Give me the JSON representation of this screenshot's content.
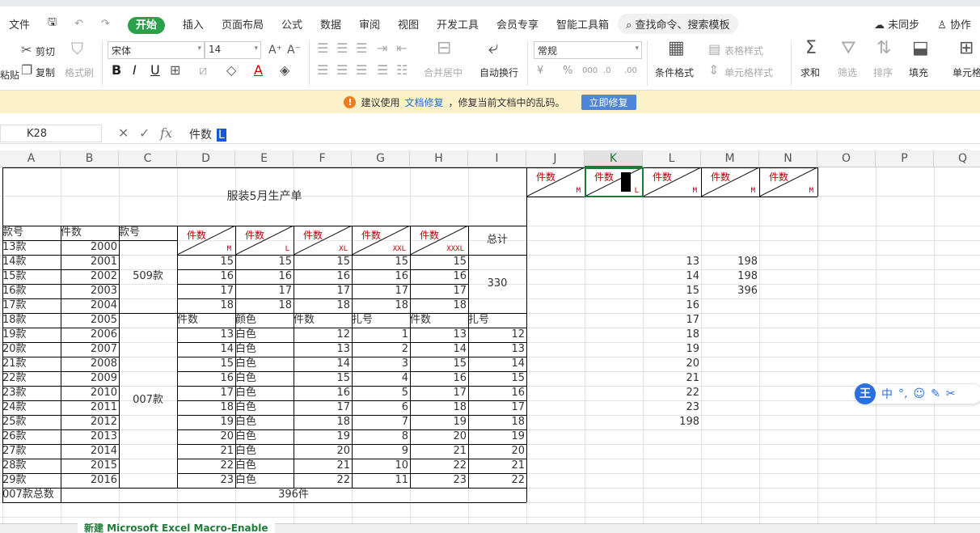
{
  "menubar": {
    "file": "文件",
    "items": [
      "开始",
      "插入",
      "页面布局",
      "公式",
      "数据",
      "审阅",
      "视图",
      "开发工具",
      "会员专享",
      "智能工具箱"
    ],
    "search": "查找命令、搜索模板",
    "sync": "未同步",
    "collab": "协作"
  },
  "ribbon": {
    "cut": "剪切",
    "copy": "复制",
    "format_painter": "格式刷",
    "font_name": "宋体",
    "font_size": "14",
    "merge": "合并居中",
    "wrap": "自动换行",
    "number_format": "常规",
    "cond_format": "条件格式",
    "table_style": "表格样式",
    "cell_style": "单元格样式",
    "sum": "求和",
    "filter": "筛选",
    "sort": "排序",
    "fill": "填充",
    "cell": "单元格",
    "paste": "粘贴"
  },
  "notice": {
    "text1": "建议使用",
    "link": "文档修复",
    "text2": "，修复当前文档中的乱码。",
    "button": "立即修复"
  },
  "formula": {
    "cell_ref": "K28",
    "content": "件数",
    "cursor": "L"
  },
  "columns": [
    "A",
    "B",
    "C",
    "D",
    "E",
    "F",
    "G",
    "H",
    "I",
    "J",
    "K",
    "L",
    "M",
    "N",
    "O",
    "P",
    "Q"
  ],
  "active_column": "K",
  "sheet": {
    "title": "服装5月生产单",
    "headers": {
      "style": "款号",
      "qty": "件数",
      "model": "款号",
      "total": "总计"
    },
    "diag_top": "件数",
    "sizes": [
      "M",
      "L",
      "XL",
      "XXL",
      "XXXL"
    ],
    "jn_sizes": [
      "M",
      "L",
      "M",
      "M",
      "M"
    ],
    "group1_label": "509款",
    "group1_total": "330",
    "group1_rows": [
      {
        "style": "13款",
        "qty": "2000",
        "vals": [
          "",
          "",
          "",
          "",
          ""
        ]
      },
      {
        "style": "14款",
        "qty": "2001",
        "vals": [
          "15",
          "15",
          "15",
          "15",
          "15"
        ]
      },
      {
        "style": "15款",
        "qty": "2002",
        "vals": [
          "16",
          "16",
          "16",
          "16",
          "16"
        ]
      },
      {
        "style": "16款",
        "qty": "2003",
        "vals": [
          "17",
          "17",
          "17",
          "17",
          "17"
        ]
      },
      {
        "style": "17款",
        "qty": "2004",
        "vals": [
          "18",
          "18",
          "18",
          "18",
          "18"
        ]
      }
    ],
    "group2_label": "007款",
    "group2_headers": [
      "件数",
      "颜色",
      "件数",
      "扎号",
      "件数",
      "扎号"
    ],
    "group2_rows": [
      {
        "style": "18款",
        "qty": "2005"
      },
      {
        "style": "19款",
        "qty": "2006",
        "d": "13",
        "e": "白色",
        "f": "12",
        "g": "1",
        "h": "13",
        "i": "12"
      },
      {
        "style": "20款",
        "qty": "2007",
        "d": "14",
        "e": "白色",
        "f": "13",
        "g": "2",
        "h": "14",
        "i": "13"
      },
      {
        "style": "21款",
        "qty": "2008",
        "d": "15",
        "e": "白色",
        "f": "14",
        "g": "3",
        "h": "15",
        "i": "14"
      },
      {
        "style": "22款",
        "qty": "2009",
        "d": "16",
        "e": "白色",
        "f": "15",
        "g": "4",
        "h": "16",
        "i": "15"
      },
      {
        "style": "23款",
        "qty": "2010",
        "d": "17",
        "e": "白色",
        "f": "16",
        "g": "5",
        "h": "17",
        "i": "16"
      },
      {
        "style": "24款",
        "qty": "2011",
        "d": "18",
        "e": "白色",
        "f": "17",
        "g": "6",
        "h": "18",
        "i": "17"
      },
      {
        "style": "25款",
        "qty": "2012",
        "d": "19",
        "e": "白色",
        "f": "18",
        "g": "7",
        "h": "19",
        "i": "18"
      },
      {
        "style": "26款",
        "qty": "2013",
        "d": "20",
        "e": "白色",
        "f": "19",
        "g": "8",
        "h": "20",
        "i": "19"
      },
      {
        "style": "27款",
        "qty": "2014",
        "d": "21",
        "e": "白色",
        "f": "20",
        "g": "9",
        "h": "21",
        "i": "20"
      },
      {
        "style": "28款",
        "qty": "2015",
        "d": "22",
        "e": "白色",
        "f": "21",
        "g": "10",
        "h": "22",
        "i": "21"
      },
      {
        "style": "29款",
        "qty": "2016",
        "d": "23",
        "e": "白色",
        "f": "22",
        "g": "11",
        "h": "23",
        "i": "22"
      }
    ],
    "footer_label": "007款总数",
    "footer_value": "396件",
    "col_l": [
      "13",
      "14",
      "15",
      "16",
      "17",
      "18",
      "19",
      "20",
      "21",
      "22",
      "23",
      "198"
    ],
    "col_m": [
      "198",
      "198",
      "396"
    ]
  },
  "sheet_tab": "新建 Microsoft Excel Macro-Enable",
  "ime": {
    "logo": "王",
    "mode": "中"
  },
  "colors": {
    "accent_green": "#2ba04a",
    "red_text": "#c00000",
    "notice_bg": "#fdf1c9",
    "link_blue": "#1a6fd6"
  }
}
